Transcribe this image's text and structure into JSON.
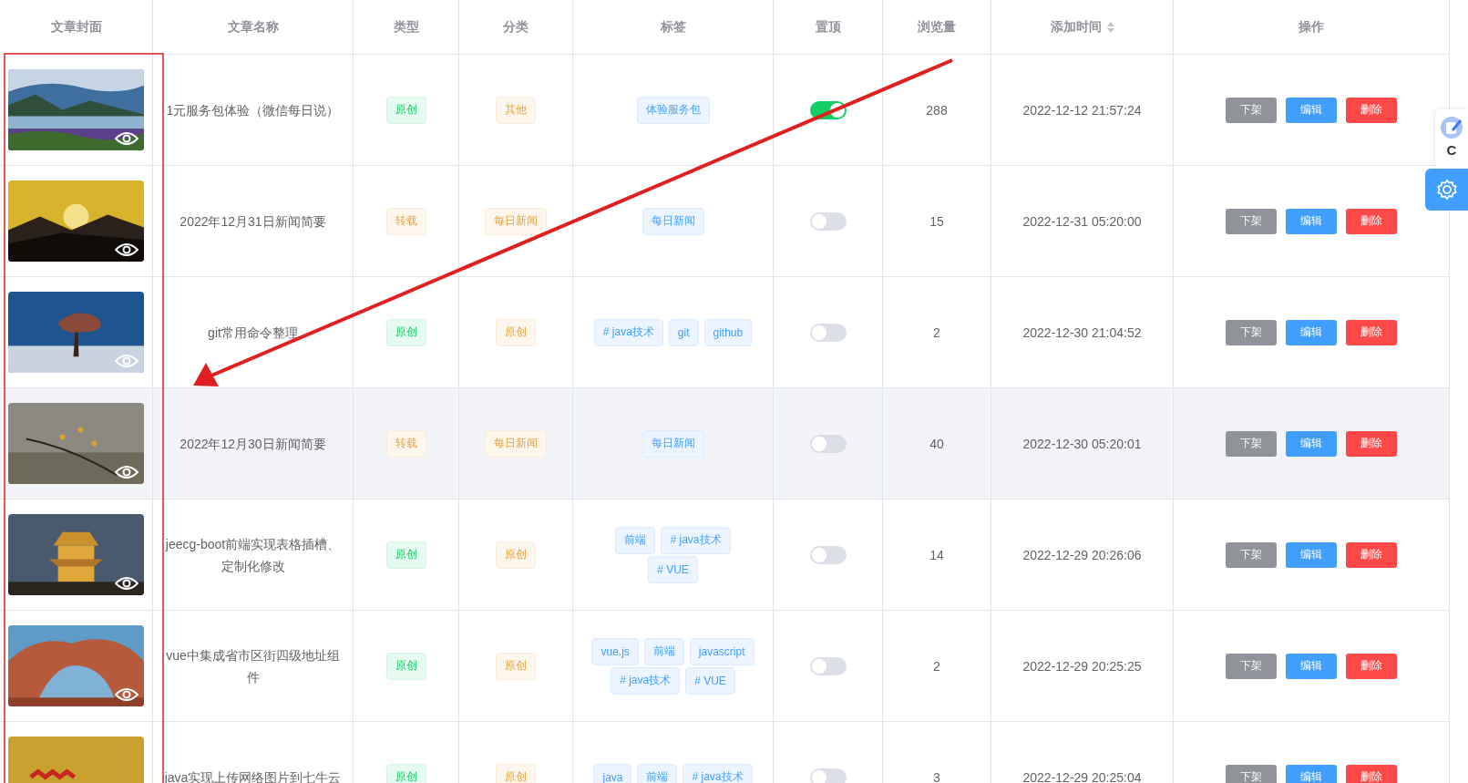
{
  "table": {
    "columns": [
      {
        "label": "文章封面"
      },
      {
        "label": "文章名称"
      },
      {
        "label": "类型"
      },
      {
        "label": "分类"
      },
      {
        "label": "标签"
      },
      {
        "label": "置顶"
      },
      {
        "label": "浏览量"
      },
      {
        "label": "添加时间",
        "sortable": true
      },
      {
        "label": "操作"
      }
    ],
    "rows": [
      {
        "title": "1元服务包体验（微信每日说）",
        "type": {
          "text": "原创",
          "kind": "original"
        },
        "category": "其他",
        "tags": [
          "体验服务包"
        ],
        "pinned": true,
        "views": "288",
        "added": "2022-12-12 21:57:24",
        "actions": [
          "下架",
          "编辑",
          "删除"
        ],
        "highlighted": false
      },
      {
        "title": "2022年12月31日新闻简要",
        "type": {
          "text": "转载",
          "kind": "reposted"
        },
        "category": "每日新闻",
        "tags": [
          "每日新闻"
        ],
        "pinned": false,
        "views": "15",
        "added": "2022-12-31 05:20:00",
        "actions": [
          "下架",
          "编辑",
          "删除"
        ],
        "highlighted": false
      },
      {
        "title": "git常用命令整理",
        "type": {
          "text": "原创",
          "kind": "original"
        },
        "category": "原创",
        "tags": [
          "# java技术",
          "git",
          "github"
        ],
        "pinned": false,
        "views": "2",
        "added": "2022-12-30 21:04:52",
        "actions": [
          "下架",
          "编辑",
          "删除"
        ],
        "highlighted": false
      },
      {
        "title": "2022年12月30日新闻简要",
        "type": {
          "text": "转载",
          "kind": "reposted"
        },
        "category": "每日新闻",
        "tags": [
          "每日新闻"
        ],
        "pinned": false,
        "views": "40",
        "added": "2022-12-30 05:20:01",
        "actions": [
          "下架",
          "编辑",
          "删除"
        ],
        "highlighted": true
      },
      {
        "title": "jeecg-boot前端实现表格插槽、定制化修改",
        "type": {
          "text": "原创",
          "kind": "original"
        },
        "category": "原创",
        "tags": [
          "前端",
          "# java技术",
          "# VUE"
        ],
        "pinned": false,
        "views": "14",
        "added": "2022-12-29 20:26:06",
        "actions": [
          "下架",
          "编辑",
          "删除"
        ],
        "highlighted": false
      },
      {
        "title": "vue中集成省市区街四级地址组件",
        "type": {
          "text": "原创",
          "kind": "original"
        },
        "category": "原创",
        "tags": [
          "vue.js",
          "前端",
          "javascript",
          "# java技术",
          "# VUE"
        ],
        "pinned": false,
        "views": "2",
        "added": "2022-12-29 20:25:25",
        "actions": [
          "下架",
          "编辑",
          "删除"
        ],
        "highlighted": false
      },
      {
        "title": "java实现上传网络图片到七牛云",
        "type": {
          "text": "原创",
          "kind": "original"
        },
        "category": "原创",
        "tags": [
          "java",
          "前端",
          "# java技术"
        ],
        "pinned": false,
        "views": "3",
        "added": "2022-12-29 20:25:04",
        "actions": [
          "下架",
          "编辑",
          "删除"
        ],
        "highlighted": false
      }
    ]
  },
  "side_panel": {
    "label": "C"
  }
}
